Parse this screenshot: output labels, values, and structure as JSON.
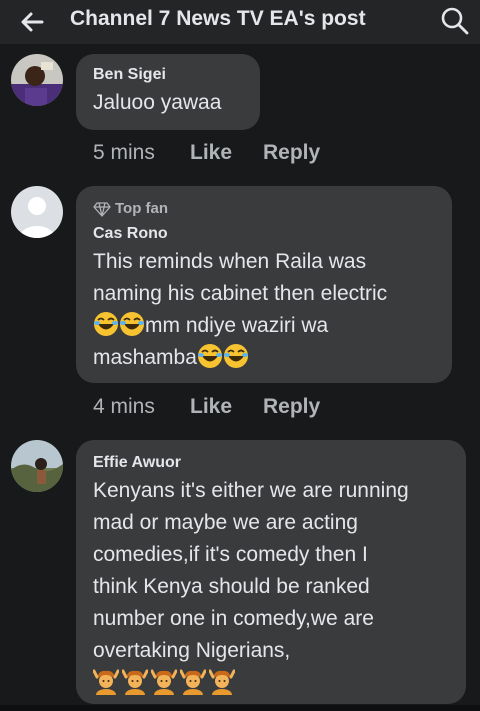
{
  "header": {
    "title": "Channel 7 News TV EA's post",
    "back_icon": "arrow-left-icon",
    "search_icon": "search-icon"
  },
  "comments": [
    {
      "author": "Ben Sigei",
      "text": "Jaluoo yawaa",
      "time": "5 mins",
      "like_label": "Like",
      "reply_label": "Reply"
    },
    {
      "badge": "Top fan",
      "author": "Cas Rono",
      "line1": "This reminds when Raila was",
      "line2": "naming his cabinet then electric",
      "line3_text": "mm ndiye waziri wa",
      "line4_text": "mashamba",
      "time": "4 mins",
      "like_label": "Like",
      "reply_label": "Reply"
    },
    {
      "author": "Effie Awuor",
      "lines": [
        "Kenyans it's either we are running",
        "mad or maybe we are acting",
        "comedies,if it's comedy then I",
        "think Kenya should be ranked",
        "number one in comedy,we are",
        "overtaking Nigerians,"
      ]
    }
  ],
  "colors": {
    "background": "#18191a",
    "bubble": "#3a3b3c",
    "text": "#e4e6eb",
    "secondary": "#b0b3b8"
  }
}
